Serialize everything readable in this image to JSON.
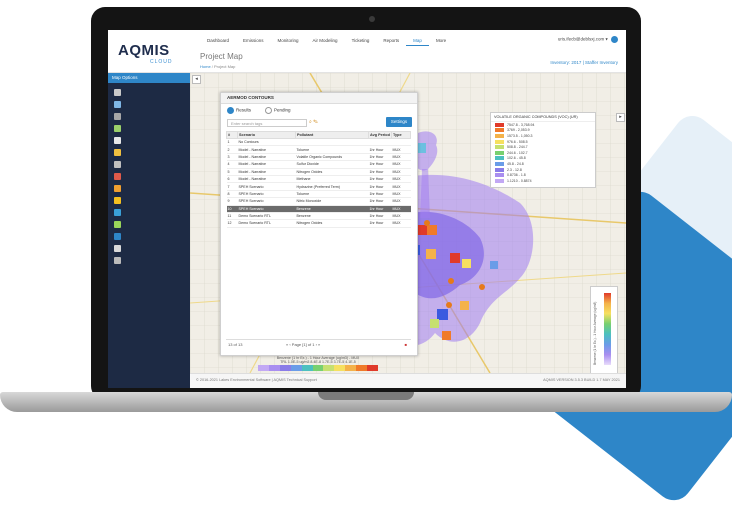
{
  "brand": {
    "logo": "AQMIS",
    "logo_sub": "CLOUD"
  },
  "nav": {
    "items": [
      "Dashboard",
      "Emissions",
      "Monitoring",
      "Air Modeling",
      "Ticketing",
      "Reports",
      "Map",
      "More"
    ],
    "active": "Map"
  },
  "user": {
    "label": "uris.ifecb@deblsxj.com"
  },
  "page": {
    "title": "Project Map",
    "breadcrumb_home": "Home",
    "breadcrumb_current": "Project Map",
    "inventory": "Inventory: 2017 | Staffer Inventory"
  },
  "sidebar": {
    "title": "Map Options"
  },
  "panel": {
    "title": "AERMOD CONTOURS",
    "radio_results": "Results",
    "radio_pending": "Pending",
    "search_placeholder": "Enter search tags",
    "settings_label": "Settings",
    "columns": [
      "#",
      "Scenario",
      "Pollutant",
      "Avg Period",
      "Type"
    ],
    "rows": [
      [
        "1",
        "No Contours",
        "",
        "",
        ""
      ],
      [
        "2",
        "Model - Narrative",
        "Toluene",
        "1hr Hour",
        "MUX"
      ],
      [
        "3",
        "Model - Narrative",
        "Volatile Organic Compounds",
        "1hr Hour",
        "MUX"
      ],
      [
        "4",
        "Model - Narrative",
        "Sulfur Dioxide",
        "1hr Hour",
        "MUX"
      ],
      [
        "5",
        "Model - Narrative",
        "Nitrogen Oxides",
        "1hr Hour",
        "MUX"
      ],
      [
        "6",
        "Model - Narrative",
        "Methane",
        "1hr Hour",
        "MUX"
      ],
      [
        "7",
        "SPEH Scenario",
        "Hydrazine (Preferred Term)",
        "1hr Hour",
        "MUX"
      ],
      [
        "8",
        "SPEH Scenario",
        "Toluene",
        "1hr Hour",
        "MUX"
      ],
      [
        "9",
        "SPEH Scenario",
        "Nitric Monoxide",
        "1hr Hour",
        "MUX"
      ],
      [
        "10",
        "SPEH Scenario",
        "Benzene",
        "1hr Hour",
        "MUX"
      ],
      [
        "11",
        "Demo Scenario RTL",
        "Benzene",
        "1hr Hour",
        "MUX"
      ],
      [
        "12",
        "Demo Scenario RTL",
        "Nitrogen Oxides",
        "1hr Hour",
        "MUX"
      ]
    ],
    "selected_row": 9,
    "pager_count": "13 of 13",
    "pager_page": "Page",
    "pager_of": "of 1",
    "scale_caption_1": "Benzene (1 hr Ex.) - 1 Hour Average (ug/m3) - MUX",
    "scale_caption_2": "TRL 1.0E-5 ug/m3  8.4E-8  1.7E-5  3.7E-5  4.1E-5"
  },
  "legend": {
    "title": "VOLATILE ORGANIC COMPOUNDS (VOC) (UR)",
    "entries": [
      {
        "label": "7547.8 - 3,768.94",
        "color": "#e03a2a"
      },
      {
        "label": "3769 - 2,053.9",
        "color": "#f07a2a"
      },
      {
        "label": "1573.5 - 1,050.3",
        "color": "#f4b24a"
      },
      {
        "label": "976.6 - 508.5",
        "color": "#f6e060"
      },
      {
        "label": "508.8 - 244.7",
        "color": "#c6e070"
      },
      {
        "label": "244.6 - 102.7",
        "color": "#78d070"
      },
      {
        "label": "102.6 - 45.8",
        "color": "#4cc0c0"
      },
      {
        "label": "45.8 - 24.8",
        "color": "#6a9ce8"
      },
      {
        "label": "2.3 - 12.8",
        "color": "#8a7ce8"
      },
      {
        "label": "0.8736 - 1.8",
        "color": "#a98ef0"
      },
      {
        "label": "1.1210 - 0.8874",
        "color": "#c2a8f4"
      }
    ]
  },
  "vbar": {
    "label": "Benzene (1 hr Ex.) - 1 Hour Average (ug/m3)"
  },
  "footer": {
    "left": "© 2016-2021 Lakes Environmental Software | AQMIS Technical Support",
    "right": "AQMIS VERSION 3.5.3 BUILD 1.7 MAY 2021"
  }
}
